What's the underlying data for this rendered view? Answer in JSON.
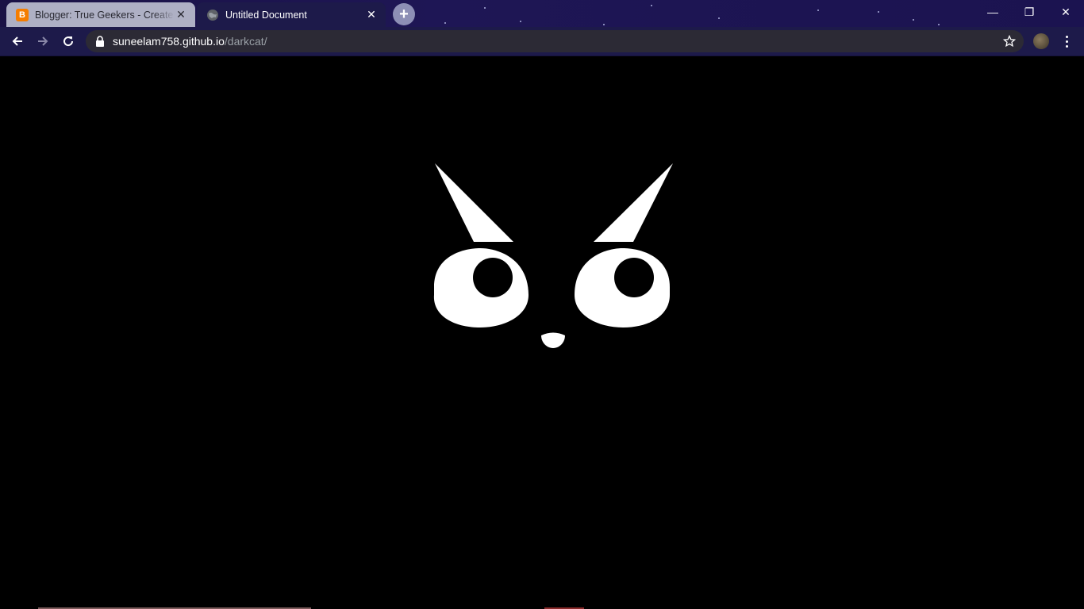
{
  "tabs": [
    {
      "title": "Blogger: True Geekers - Create post",
      "favicon": "blogger-icon",
      "active": false
    },
    {
      "title": "Untitled Document",
      "favicon": "globe-icon",
      "active": true
    }
  ],
  "omnibox": {
    "host": "suneelam758.github.io",
    "path": "/darkcat/"
  },
  "window_controls": {
    "minimize": "—",
    "restore": "❐",
    "close": "✕"
  },
  "theme": {
    "accent": "#1d1a4a",
    "page_bg": "#000000",
    "cat_color": "#ffffff"
  }
}
